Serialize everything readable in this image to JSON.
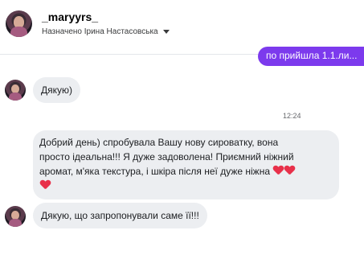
{
  "header": {
    "username": "_maryyrs_",
    "assigned": "Назначено Ірина Настасовська"
  },
  "outgoing": {
    "text": "по прийшла 1.1.ли..."
  },
  "messages": [
    {
      "text": "Дякую)"
    },
    {
      "line1": "Добрий день) спробувала Вашу нову сироватку, вона",
      "line2": "просто ідеальна!!! Я дуже задоволена! Приємний ніжний",
      "line3": "аромат, м'яка текстура, і шкіра після неї  дуже ніжна"
    },
    {
      "text": "Дякую, що запропонували саме її!!!"
    }
  ],
  "timestamp": "12:24",
  "icons": {
    "heart": "heart-icon",
    "dropdown": "caret-icon"
  },
  "colors": {
    "outgoing_bubble": "#7c3aed",
    "incoming_bubble": "#eceef1",
    "heart": "#e8304a"
  }
}
